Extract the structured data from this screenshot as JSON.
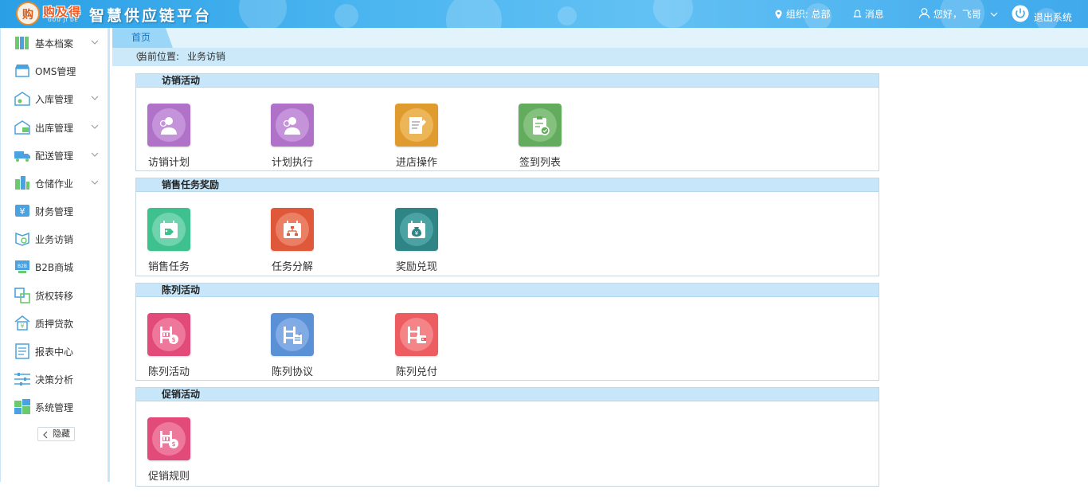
{
  "header": {
    "logo_text": "购及得",
    "logo_sub": "GOU JI DE",
    "app_title": "智慧供应链平台",
    "org_label": "组织: 总部",
    "messages_label": "消息",
    "greeting": "您好，飞哥",
    "logout_label": "退出系统"
  },
  "sidebar": {
    "items": [
      {
        "label": "基本档案",
        "icon": "archive-icon",
        "expandable": true
      },
      {
        "label": "OMS管理",
        "icon": "store-icon",
        "expandable": false
      },
      {
        "label": "入库管理",
        "icon": "inbound-icon",
        "expandable": true
      },
      {
        "label": "出库管理",
        "icon": "outbound-icon",
        "expandable": true
      },
      {
        "label": "配送管理",
        "icon": "truck-icon",
        "expandable": true
      },
      {
        "label": "仓储作业",
        "icon": "warehouse-icon",
        "expandable": true
      },
      {
        "label": "财务管理",
        "icon": "finance-icon",
        "expandable": false
      },
      {
        "label": "业务访销",
        "icon": "visit-sales-icon",
        "expandable": false
      },
      {
        "label": "B2B商城",
        "icon": "b2b-icon",
        "expandable": false
      },
      {
        "label": "货权转移",
        "icon": "transfer-icon",
        "expandable": false
      },
      {
        "label": "质押贷款",
        "icon": "loan-icon",
        "expandable": false
      },
      {
        "label": "报表中心",
        "icon": "report-icon",
        "expandable": false
      },
      {
        "label": "决策分析",
        "icon": "analysis-icon",
        "expandable": false
      },
      {
        "label": "系统管理",
        "icon": "system-icon",
        "expandable": false
      }
    ],
    "hide_label": "隐藏"
  },
  "tabs": [
    {
      "label": "首页"
    }
  ],
  "breadcrumb": {
    "prefix": "当前位置:",
    "current": "业务访销"
  },
  "sections": [
    {
      "title": "访销活动",
      "tiles": [
        {
          "label": "访销计划",
          "color": "#b072c9",
          "inner": "#c493d9",
          "icon": "person-icon"
        },
        {
          "label": "计划执行",
          "color": "#b072c9",
          "inner": "#c493d9",
          "icon": "person-icon"
        },
        {
          "label": "进店操作",
          "color": "#e09b2f",
          "inner": "#ecb658",
          "icon": "notepad-icon"
        },
        {
          "label": "签到列表",
          "color": "#63ac5d",
          "inner": "#84c07e",
          "icon": "clipboard-check-icon"
        }
      ]
    },
    {
      "title": "销售任务奖励",
      "tiles": [
        {
          "label": "销售任务",
          "color": "#3ec18f",
          "inner": "#6fd4ad",
          "icon": "calendar-tag-icon"
        },
        {
          "label": "任务分解",
          "color": "#e0583a",
          "inner": "#ea7f64",
          "icon": "calendar-tree-icon"
        },
        {
          "label": "奖励兑现",
          "color": "#2f8486",
          "inner": "#4aa2a3",
          "icon": "money-bag-icon"
        }
      ]
    },
    {
      "title": "陈列活动",
      "tiles": [
        {
          "label": "陈列活动",
          "color": "#e14a79",
          "inner": "#ee779c",
          "icon": "shelf-coin-icon"
        },
        {
          "label": "陈列协议",
          "color": "#5a90d6",
          "inner": "#80abe5",
          "icon": "shelf-doc-icon"
        },
        {
          "label": "陈列兑付",
          "color": "#ec5c60",
          "inner": "#f48487",
          "icon": "shelf-wallet-icon"
        }
      ]
    },
    {
      "title": "促销活动",
      "tiles": [
        {
          "label": "促销规则",
          "color": "#e14a79",
          "inner": "#ee779c",
          "icon": "shelf-coin-icon"
        }
      ]
    }
  ]
}
